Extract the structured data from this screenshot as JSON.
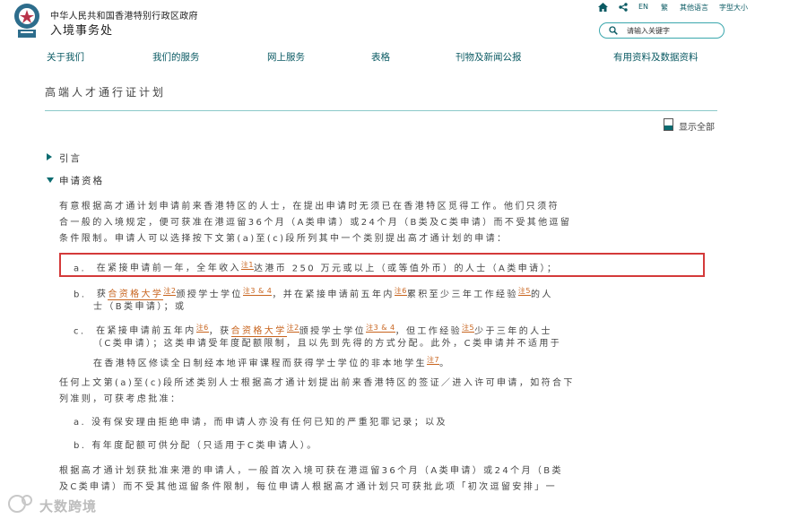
{
  "header": {
    "gov_name": "中华人民共和国香港特别行政区政府",
    "dept_name": "入境事务处",
    "util": {
      "lang_en": "EN",
      "lang_trad": "繁",
      "other_lang": "其他语言",
      "font_size": "字型大小"
    },
    "search_placeholder": "请输入关键字"
  },
  "nav": [
    "关于我们",
    "我们的服务",
    "网上服务",
    "表格",
    "刊物及新闻公报",
    "有用资料及数据资料"
  ],
  "page": {
    "title": "高端人才通行证计划",
    "show_all": "显示全部",
    "sections": {
      "intro": "引言",
      "eligibility": "申请资格"
    },
    "para1": [
      "有意根据高才通计划申请前来香港特区的人士，在提出申请时无须已在香港特区觅得工作。他们只须符",
      "合一般的入境规定，便可获准在港逗留36个月（A类申请）或24个月（B类及C类申请）而不受其他逗留",
      "条件限制。申请人可以选择按下文第(a)至(c)段所列其中一个类别提出高才通计划的申请："
    ],
    "item_a": {
      "label": "a.",
      "text1": "在紧接申请前一年，全年收入",
      "note1": "注1",
      "text2": "达港币 250 万元或以上（或等值外币）的人士（A类申请）；"
    },
    "item_b": {
      "label": "b.",
      "t1": "获",
      "link": "合资格大学",
      "n1": "注2",
      "t2": "颁授学士学位",
      "n2": "注3 & 4",
      "t3": "，并在紧接申请前五年内",
      "n3": "注6",
      "t4": "累积至少三年工作经验",
      "n4": "注5",
      "t5": "的人",
      "line2": "士（B类申请）；或"
    },
    "item_c": {
      "label": "c.",
      "t1": "在紧接申请前五年内",
      "n1": "注6",
      "t2": "，获",
      "link": "合资格大学",
      "n2": "注2",
      "t3": "颁授学士学位",
      "n3": "注3 & 4",
      "t4": "，但工作经验",
      "n4": "注5",
      "t5": "少于三年的人士",
      "line2": "（C类申请）；这类申请受年度配额限制，且以先到先得的方式分配。此外，C类申请并不适用于",
      "line3": "在香港特区修读全日制经本地评审课程而获得学士学位的非本地学生",
      "n5": "注7",
      "t6": "。"
    },
    "para2": [
      "任何上文第(a)至(c)段所述类别人士根据高才通计划提出前来香港特区的签证／进入许可申请，如符合下",
      "列准则，可获考虑批准："
    ],
    "crit_a": {
      "label": "a.",
      "text": "没有保安理由拒绝申请，而申请人亦没有任何已知的严重犯罪记录；以及"
    },
    "crit_b": {
      "label": "b.",
      "text": "有年度配额可供分配（只适用于C类申请人）。"
    },
    "para3": [
      "根据高才通计划获批准来港的申请人，一般首次入境可获在港逗留36个月（A类申请）或24个月（B类",
      "及C类申请）而不受其他逗留条件限制，每位申请人根据高才通计划只可获批此项「初次逗留安排」一"
    ]
  },
  "watermark": "大数跨境",
  "colors": {
    "accent": "#0a6b70",
    "note": "#c8641e",
    "highlight": "#d43a3a"
  }
}
